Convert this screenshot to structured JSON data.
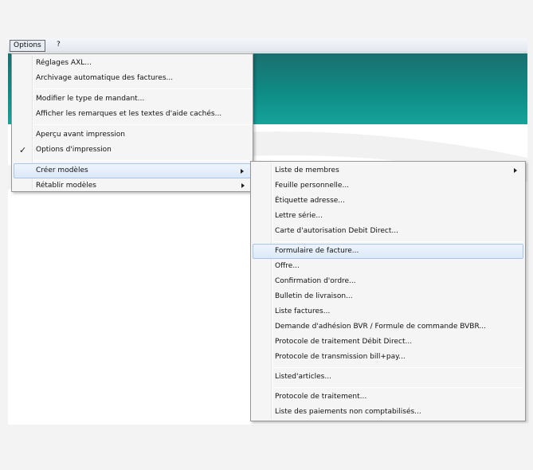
{
  "menubar": {
    "options_label": "Options",
    "help_label": "?"
  },
  "main_menu": {
    "items": [
      {
        "label": "Réglages AXL..."
      },
      {
        "label": "Archivage automatique des factures..."
      },
      {
        "label": "Modifier le type de mandant..."
      },
      {
        "label": "Afficher les remarques et les textes d'aide cachés..."
      },
      {
        "label": "Aperçu avant impression"
      },
      {
        "label": "Options d'impression",
        "checked": true
      },
      {
        "label": "Créer modèles",
        "submenu": true,
        "highlighted": true
      },
      {
        "label": "Rétablir modèles",
        "submenu": true
      }
    ]
  },
  "sub_menu": {
    "items": [
      {
        "label": "Liste de membres",
        "submenu": true
      },
      {
        "label": "Feuille personnelle..."
      },
      {
        "label": "Étiquette adresse..."
      },
      {
        "label": "Lettre série..."
      },
      {
        "label": "Carte d'autorisation Debit Direct..."
      },
      {
        "label": "Formulaire de facture...",
        "highlighted": true
      },
      {
        "label": "Offre..."
      },
      {
        "label": "Confirmation d'ordre..."
      },
      {
        "label": "Bulletin de livraison..."
      },
      {
        "label": "Liste factures..."
      },
      {
        "label": "Demande d'adhésion BVR / Formule de commande BVBR..."
      },
      {
        "label": "Protocole de traitement Débit Direct..."
      },
      {
        "label": "Protocole de transmission bill+pay..."
      },
      {
        "label": "Listed'articles..."
      },
      {
        "label": "Protocole de traitement..."
      },
      {
        "label": "Liste des paiements non comptabilisés..."
      }
    ]
  },
  "colors": {
    "banner": "#0f8b85",
    "highlight": "#dce9f8",
    "menu_bg": "#f5f5f5"
  },
  "icons": {
    "check": "check-icon",
    "submenu_arrow": "chevron-right-icon"
  }
}
